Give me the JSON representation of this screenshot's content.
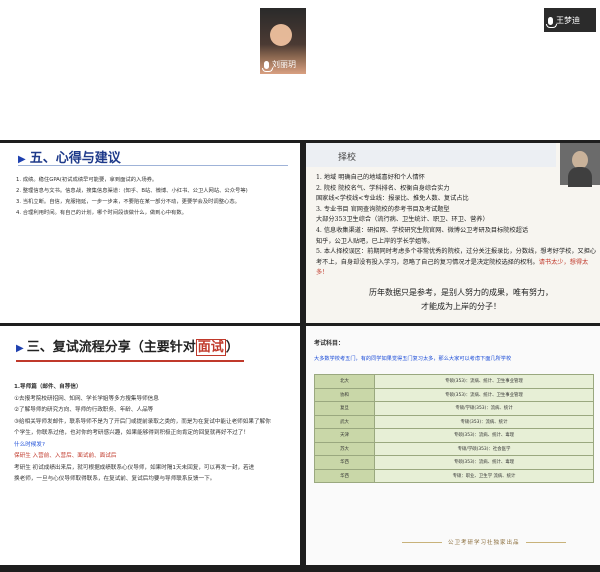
{
  "participants": [
    {
      "name": "刘丽玥"
    },
    {
      "name": "王梦迪"
    }
  ],
  "slide1": {
    "title": "五、心得与建议",
    "lines": [
      "1. 成绩。稳住GPA(初试成绩早可能要，拿到面试的入场券。",
      "2. 整理信息与文书。信息战，搜集信息渠道：(知乎、B站、微博、小红书、公卫人网站、公众号等)",
      "3. 当机立断。自信，克服拖延，一步一步来，不要陷在某一部分不动，更要学会及时调整心态。",
      "4. 合理利用时间。有自己的计划，哪个时间段该做什么，做到心中有数。"
    ]
  },
  "slide2": {
    "title": "择校",
    "lines": [
      "1. 地域  明确自己的地域喜好和个人情怀",
      "2. 院校  院校名气、学科排名、权衡自身综合实力",
      "    国家线<学校线<专业线：报录比、推免人数、复试占比",
      "3. 专业书目  官网查询院校的参考书目及考试题型",
      "    大部分353卫生综合（流行病、卫生统计、职卫、环卫、营养）",
      "4. 信息收集渠道：研招网、学校研究生院官网、微博公卫考研及目标院校超话",
      "    知乎，公卫人贴吧，已上岸的学长学姐等。",
      "5. 本人择校误区：前期同时考虑多个非常优秀的院校，过分关注报录比，分数线，想考好学校，又担心考不上，自身却没有投入学习，忽略了自己的复习情况才是决定院校选择的权利。"
    ],
    "warning": "请书太少，想得太多！",
    "footer": [
      "历年数据只是参考，是别人努力的成果，唯有努力，",
      "才能成为上岸的分子！"
    ]
  },
  "slide3": {
    "title_prefix": "三、复试流程分享（主要针对",
    "title_em": "面试",
    "title_suffix": "）",
    "lines": [
      "1.导师篇（邮件、自荐信）",
      "①去报考院校研招网、知网、学长学姐等多方搜集导师信息",
      "②了解导师的研究方向、导师的行政职务、年龄、人品等",
      "③给相关导师发邮件，联系导师不是为了开后门或提前录取之类的，而是为在复试中能让老师如果了解你",
      "个学生，你联系过他，也对你的考研感兴趣，如果能够得到积极正向肯定的回复就再好不过了！",
      "什么时候发?",
      "保研生 入营前、入营后、面试前、面试后",
      "考研生 初试成绩出来后，就可根据成绩联系心仪导师，如果时隔1天未回复，可以再发一封，若进",
      "换老师，一旦与心仪导师取得联系，在复试前、复试后均要与导师联系反馈一下。"
    ]
  },
  "slide4": {
    "title": "考试科目：",
    "subtitle": "大多数学校考五门，有的同学如果觉得五门复习太多，那么大家可以考虑下面几所学校",
    "rows": [
      {
        "school": "北大",
        "subjects": "专硕(353)：流病、统计、卫生事业管理"
      },
      {
        "school": "协和",
        "subjects": "专硕(353)：流病、统计、卫生事业管理"
      },
      {
        "school": "复旦",
        "subjects": "专硕/学硕(353)：流病、统计"
      },
      {
        "school": "武大",
        "subjects": "专硕(353)：流病、统计"
      },
      {
        "school": "天津",
        "subjects": "专硕(353)：流病、统计、毒理"
      },
      {
        "school": "苏大",
        "subjects": "专硕/学硕(353)：社会医学"
      },
      {
        "school": "华西",
        "subjects": "专硕(353)：流病、统计、毒理"
      },
      {
        "school": "华西",
        "subjects": "专硕：职业、卫生学 流病、统计"
      }
    ],
    "banner": "公卫考研学习社独家出品"
  }
}
